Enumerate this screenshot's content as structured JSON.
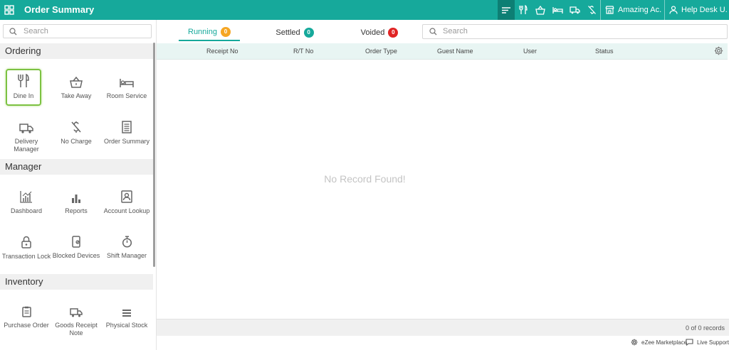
{
  "header": {
    "title": "Order Summary",
    "outlet_label": "Amazing Ac...",
    "user_label": "Help Desk U...",
    "colors": {
      "brand": "#16a99b",
      "active_tool": "#0d7f74"
    },
    "toolbar_icons": [
      "order-summary-icon",
      "dine-in-icon",
      "take-away-icon",
      "room-service-icon",
      "delivery-icon",
      "no-charge-icon"
    ]
  },
  "sidebar": {
    "search_placeholder": "Search",
    "sections": [
      {
        "title": "Ordering",
        "items": [
          {
            "label": "Dine In",
            "icon": "dine-in-icon",
            "selected": true
          },
          {
            "label": "Take Away",
            "icon": "basket-icon"
          },
          {
            "label": "Room Service",
            "icon": "bed-icon"
          },
          {
            "label": "Delivery Manager",
            "icon": "truck-icon"
          },
          {
            "label": "No Charge",
            "icon": "no-charge-icon"
          },
          {
            "label": "Order Summary",
            "icon": "order-summary-icon"
          }
        ]
      },
      {
        "title": "Manager",
        "items": [
          {
            "label": "Dashboard",
            "icon": "dashboard-icon"
          },
          {
            "label": "Reports",
            "icon": "bar-chart-icon"
          },
          {
            "label": "Account Lookup",
            "icon": "account-icon"
          },
          {
            "label": "Transaction Lock",
            "icon": "lock-icon"
          },
          {
            "label": "Blocked Devices",
            "icon": "blocked-device-icon"
          },
          {
            "label": "Shift Manager",
            "icon": "stopwatch-icon"
          }
        ]
      },
      {
        "title": "Inventory",
        "items": [
          {
            "label": "Purchase Order",
            "icon": "clipboard-icon"
          },
          {
            "label": "Goods Receipt Note",
            "icon": "truck-icon"
          },
          {
            "label": "Physical Stock",
            "icon": "stack-icon"
          }
        ]
      }
    ]
  },
  "tabs": [
    {
      "label": "Running",
      "count": "0",
      "color": "#f5a623",
      "active": true
    },
    {
      "label": "Settled",
      "count": "0",
      "color": "#16a99b"
    },
    {
      "label": "Voided",
      "count": "0",
      "color": "#e02424"
    }
  ],
  "main_search_placeholder": "Search",
  "table": {
    "columns": [
      "Receipt No",
      "R/T No",
      "Order Type",
      "Guest Name",
      "User",
      "Status"
    ],
    "empty_message": "No Record Found!",
    "record_count": "0 of 0 records"
  },
  "footer": {
    "marketplace": "eZee Marketplace",
    "support": "Live Support"
  }
}
